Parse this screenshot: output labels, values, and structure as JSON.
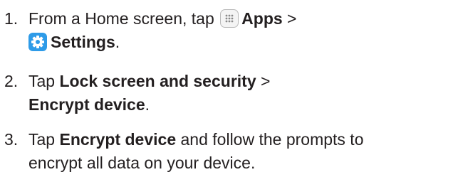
{
  "steps": [
    {
      "number": "1.",
      "prefix": "From a Home screen, tap",
      "apps_label": "Apps",
      "separator": " >",
      "settings_label": "Settings",
      "suffix": "."
    },
    {
      "number": "2.",
      "prefix": "Tap ",
      "menu_label": "Lock screen and security",
      "separator": " >",
      "option_label": "Encrypt device",
      "suffix": "."
    },
    {
      "number": "3.",
      "prefix": "Tap ",
      "action_label": "Encrypt device",
      "line1_rest": " and follow the prompts to",
      "line2": "encrypt all data on your device."
    }
  ],
  "icons": {
    "apps": "apps-grid-icon",
    "settings": "gear-icon",
    "settings_color": "#2e9be8"
  }
}
